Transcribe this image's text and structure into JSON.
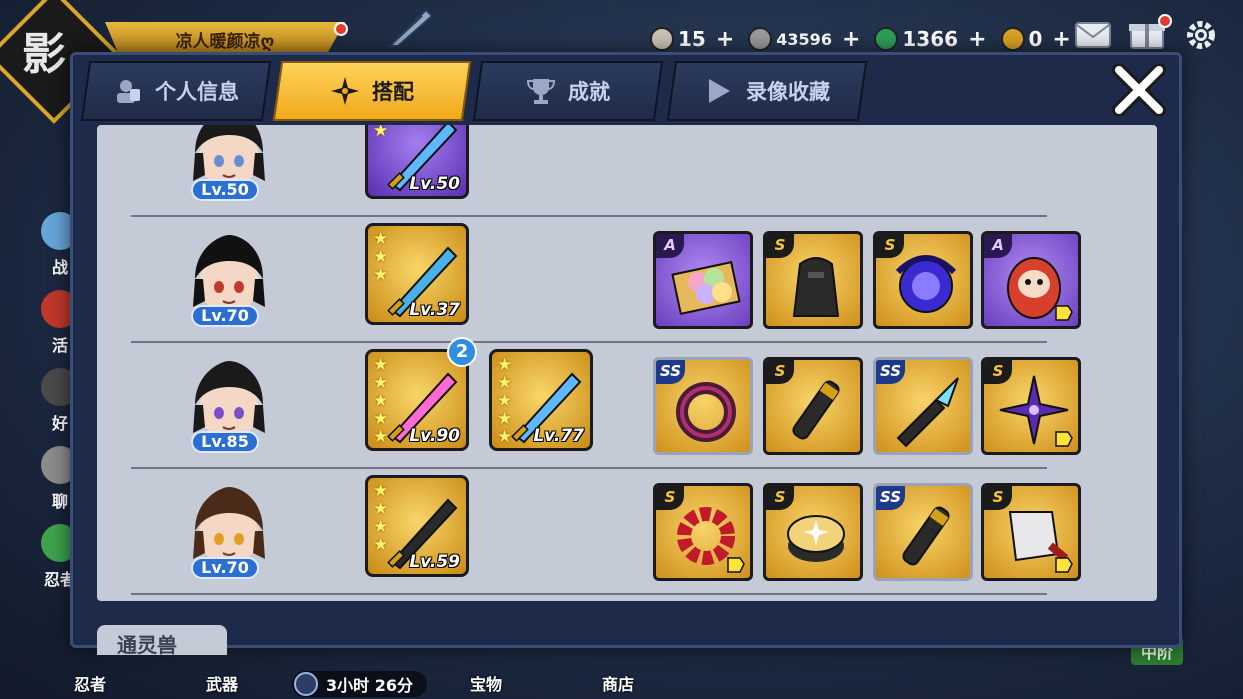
{
  "player": {
    "name": "凉人暖颜凉ღ",
    "emblem_char": "影"
  },
  "currencies": [
    {
      "icon": "dumpling-icon",
      "value": "15",
      "color": "#c9c2b5"
    },
    {
      "icon": "coin-icon",
      "value": "43596",
      "color": "#9a9a9a"
    },
    {
      "icon": "jade-icon",
      "value": "1366",
      "color": "#2e9e5a"
    },
    {
      "icon": "token-icon",
      "value": "0",
      "color": "#d9a227"
    }
  ],
  "side_menu": [
    {
      "label": "战",
      "color": "#66a6d9"
    },
    {
      "label": "活",
      "color": "#c0392b"
    },
    {
      "label": "好",
      "color": "#4a4a4a"
    },
    {
      "label": "聊",
      "color": "#8c8c8c"
    },
    {
      "label": "忍者",
      "color": "#3fa34d"
    }
  ],
  "tabs": [
    {
      "label": "个人信息",
      "icon": "profile-icon",
      "active": false
    },
    {
      "label": "搭配",
      "icon": "shuriken-icon",
      "active": true
    },
    {
      "label": "成就",
      "icon": "trophy-icon",
      "active": false
    },
    {
      "label": "录像收藏",
      "icon": "play-icon",
      "active": false
    }
  ],
  "rows": [
    {
      "level": "Lv.50",
      "avatar_color": "#1a1a1a",
      "weapons": [
        {
          "level": "Lv.50",
          "stars": 2,
          "tier": "purple"
        }
      ],
      "items": []
    },
    {
      "level": "Lv.70",
      "avatar_color": "#111111",
      "weapons": [
        {
          "level": "Lv.37",
          "stars": 3,
          "tier": "gold"
        }
      ],
      "items": [
        {
          "grade": "A",
          "tier": "a",
          "name": "dango-plate-icon",
          "flag": false
        },
        {
          "grade": "S",
          "tier": "s",
          "name": "ninja-armor-icon",
          "flag": false
        },
        {
          "grade": "S",
          "tier": "s",
          "name": "dark-orb-icon",
          "flag": false
        },
        {
          "grade": "A",
          "tier": "a",
          "name": "daruma-icon",
          "flag": true
        }
      ]
    },
    {
      "level": "Lv.85",
      "avatar_color": "#1a1a1a",
      "weapons": [
        {
          "level": "Lv.90",
          "stars": 5,
          "tier": "gold",
          "refine": "2"
        },
        {
          "level": "Lv.77",
          "stars": 5,
          "tier": "gold"
        }
      ],
      "items": [
        {
          "grade": "SS",
          "tier": "ss",
          "name": "dark-ring-icon",
          "flag": false
        },
        {
          "grade": "S",
          "tier": "s",
          "name": "scroll-handle-icon",
          "flag": false
        },
        {
          "grade": "SS",
          "tier": "ss",
          "name": "kunai-icon",
          "flag": false
        },
        {
          "grade": "S",
          "tier": "s",
          "name": "shuriken-item-icon",
          "flag": true
        }
      ]
    },
    {
      "level": "Lv.70",
      "avatar_color": "#4a2a18",
      "weapons": [
        {
          "level": "Lv.59",
          "stars": 4,
          "tier": "gold"
        }
      ],
      "items": [
        {
          "grade": "S",
          "tier": "s",
          "name": "red-beads-icon",
          "flag": true
        },
        {
          "grade": "S",
          "tier": "s",
          "name": "star-drum-icon",
          "flag": false
        },
        {
          "grade": "SS",
          "tier": "ss",
          "name": "scroll-handle-icon",
          "flag": false
        },
        {
          "grade": "S",
          "tier": "s",
          "name": "cleaver-icon",
          "flag": true
        }
      ]
    }
  ],
  "content_bottom_tab": "通灵兽",
  "bottom_nav": {
    "items": [
      "忍者",
      "武器",
      "宝物",
      "商店"
    ],
    "timer": "3小时 26分",
    "rank": "中阶"
  }
}
